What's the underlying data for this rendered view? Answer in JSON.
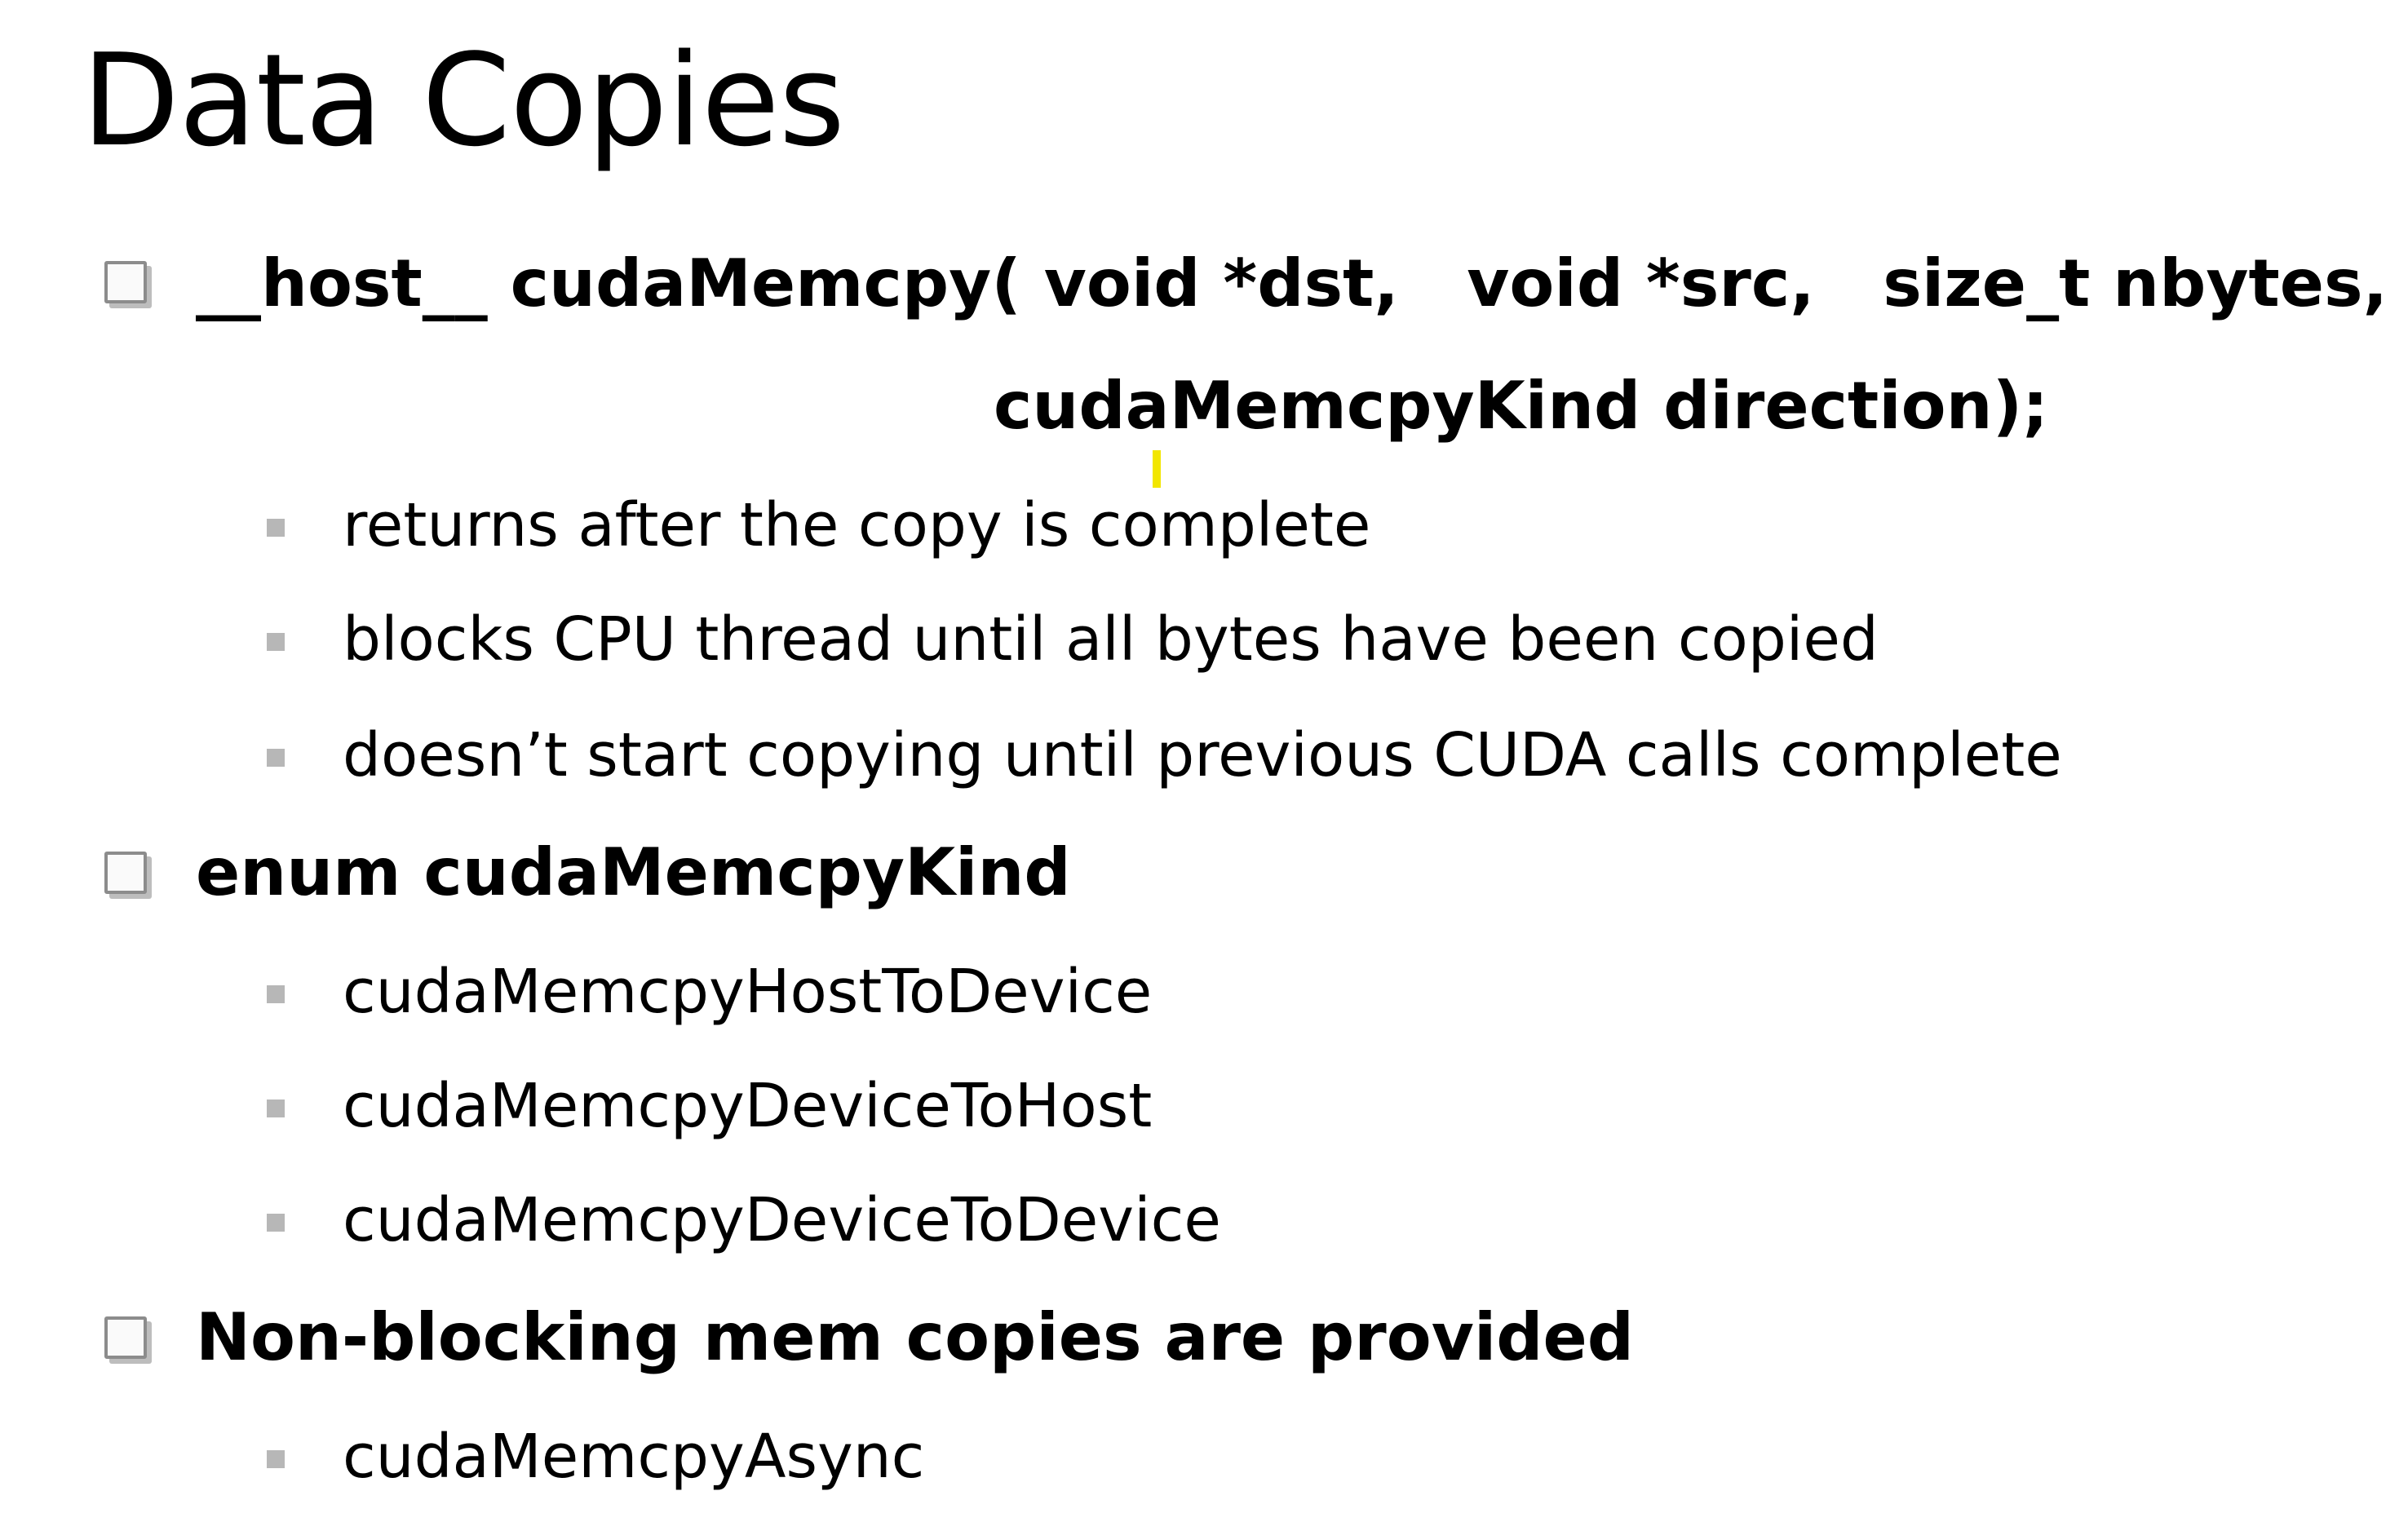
{
  "title": "Data Copies",
  "points": [
    {
      "lines": [
        "__host__ cudaMemcpy( void *dst,   void *src,   size_t nbytes,",
        "cudaMemcpyKind direction);"
      ],
      "subitems": [
        "returns after the copy is complete",
        "blocks CPU thread until all bytes have been copied",
        "doesn’t start copying until previous CUDA calls complete"
      ]
    },
    {
      "lines": [
        "enum cudaMemcpyKind"
      ],
      "subitems": [
        "cudaMemcpyHostToDevice",
        "cudaMemcpyDeviceToHost",
        "cudaMemcpyDeviceToDevice"
      ]
    },
    {
      "lines": [
        "Non-blocking mem copies are provided"
      ],
      "subitems": [
        "cudaMemcpyAsync"
      ]
    }
  ],
  "colors": {
    "text": "#000000",
    "background": "#ffffff",
    "bullet_box": "#8c8c8c",
    "bullet_square": "#b7b7b7",
    "cursor": "#f2e600"
  }
}
